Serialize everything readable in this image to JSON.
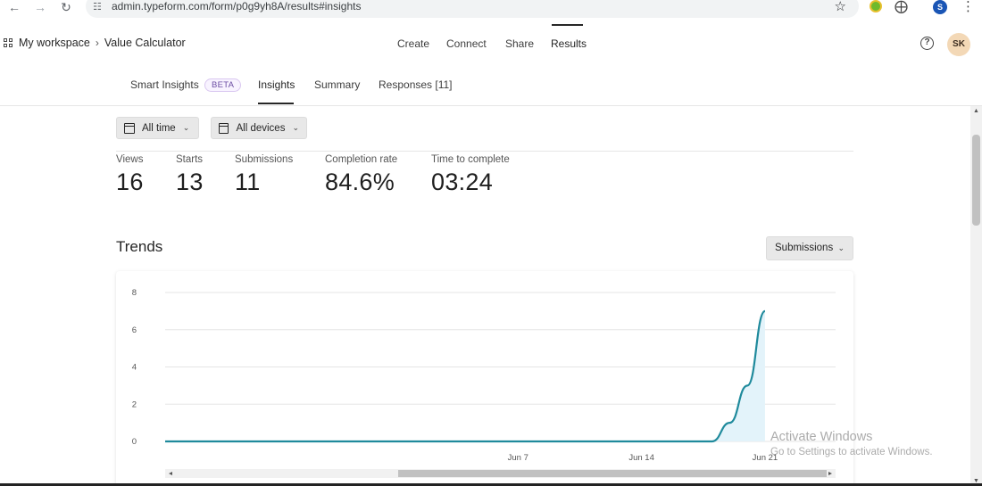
{
  "browser": {
    "url": "admin.typeform.com/form/p0g9yh8A/results#insights",
    "profile_initial": "S"
  },
  "header": {
    "workspace": "My workspace",
    "form_name": "Value Calculator",
    "nav": [
      "Create",
      "Connect",
      "Share",
      "Results"
    ],
    "active_nav": "Results",
    "avatar_initials": "SK"
  },
  "subtabs": {
    "smart_insights": "Smart Insights",
    "beta_badge": "BETA",
    "insights": "Insights",
    "summary": "Summary",
    "responses": "Responses [11]",
    "active": "Insights"
  },
  "filters": {
    "time": "All time",
    "devices": "All devices"
  },
  "stats": [
    {
      "label": "Views",
      "value": "16"
    },
    {
      "label": "Starts",
      "value": "13"
    },
    {
      "label": "Submissions",
      "value": "11"
    },
    {
      "label": "Completion rate",
      "value": "84.6%"
    },
    {
      "label": "Time to complete",
      "value": "03:24"
    }
  ],
  "trends": {
    "title": "Trends",
    "metric": "Submissions"
  },
  "chart_data": {
    "type": "area",
    "series": [
      {
        "values": [
          0,
          0,
          0,
          0,
          0,
          0,
          0,
          0,
          0,
          0,
          0,
          0,
          0,
          0,
          0,
          0,
          0,
          0,
          0,
          0,
          0,
          0,
          0,
          0,
          0,
          0,
          0,
          0,
          0,
          0,
          0,
          0,
          1,
          3,
          7
        ]
      }
    ],
    "x_tick_labels": [
      "Jun 7",
      "Jun 14",
      "Jun 21"
    ],
    "y_ticks": [
      0,
      2,
      4,
      6,
      8
    ],
    "ylim": [
      0,
      8
    ],
    "line_color": "#1f8a9c",
    "fill_color": "#e3f3fa",
    "grid": true
  },
  "watermark": {
    "line1": "Activate Windows",
    "line2": "Go to Settings to activate Windows."
  }
}
